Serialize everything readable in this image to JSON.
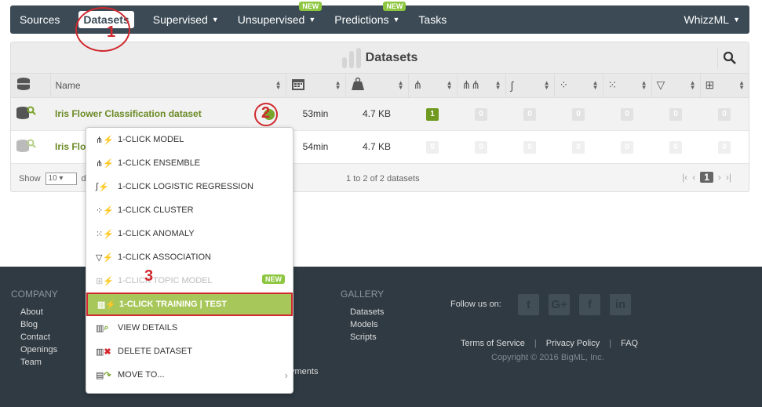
{
  "nav": {
    "items": [
      {
        "label": "Sources",
        "caret": false,
        "badge": ""
      },
      {
        "label": "Datasets",
        "caret": false,
        "badge": "",
        "active": true
      },
      {
        "label": "Supervised",
        "caret": true,
        "badge": ""
      },
      {
        "label": "Unsupervised",
        "caret": true,
        "badge": "NEW"
      },
      {
        "label": "Predictions",
        "caret": true,
        "badge": "NEW"
      },
      {
        "label": "Tasks",
        "caret": false,
        "badge": ""
      }
    ],
    "user": "WhizzML"
  },
  "panel": {
    "title": "Datasets",
    "columns": {
      "name": "Name"
    },
    "rows": [
      {
        "name": "Iris Flower Classification dataset",
        "age": "53min",
        "size": "4.7 KB",
        "counts": [
          "1",
          "0",
          "0",
          "0",
          "0",
          "0",
          "0"
        ]
      },
      {
        "name": "Iris Flo",
        "age": "54min",
        "size": "4.7 KB",
        "counts": [
          "0",
          "0",
          "0",
          "0",
          "0",
          "0",
          "0"
        ]
      }
    ],
    "footer": {
      "show_label": "Show",
      "page_size": "10",
      "range": "1 to 2 of 2 datasets",
      "page": "1",
      "trail": "d"
    }
  },
  "menu": {
    "items": [
      {
        "label": "1-CLICK MODEL",
        "icon": "model-icon"
      },
      {
        "label": "1-CLICK ENSEMBLE",
        "icon": "ensemble-icon"
      },
      {
        "label": "1-CLICK LOGISTIC REGRESSION",
        "icon": "logistic-icon"
      },
      {
        "label": "1-CLICK CLUSTER",
        "icon": "cluster-icon"
      },
      {
        "label": "1-CLICK ANOMALY",
        "icon": "anomaly-icon"
      },
      {
        "label": "1-CLICK ASSOCIATION",
        "icon": "association-icon"
      },
      {
        "label": "1-CLICK TOPIC MODEL",
        "icon": "topic-model-icon",
        "badge": "NEW"
      },
      {
        "label": "1-CLICK TRAINING | TEST",
        "icon": "training-test-icon"
      },
      {
        "label": "VIEW DETAILS",
        "icon": "view-details-icon"
      },
      {
        "label": "DELETE DATASET",
        "icon": "delete-icon"
      },
      {
        "label": "MOVE TO...",
        "icon": "move-to-icon"
      }
    ]
  },
  "footer": {
    "company_title": "COMPANY",
    "company_links": [
      "About",
      "Blog",
      "Contact",
      "Openings",
      "Team"
    ],
    "gallery_title": "GALLERY",
    "gallery_links": [
      "Datasets",
      "Models",
      "Scripts"
    ],
    "partial_text": "yments",
    "follow": "Follow us on:",
    "social": [
      "twitter-icon",
      "google-plus-icon",
      "facebook-icon",
      "linkedin-icon"
    ],
    "legal": [
      "Terms of Service",
      "Privacy Policy",
      "FAQ"
    ],
    "copyright": "Copyright © 2016 BigML, Inc."
  },
  "annotations": [
    "1",
    "2",
    "3"
  ],
  "colors": {
    "nav_bg": "#3b4a55",
    "accent_green": "#8dc63f",
    "highlight": "#a8c75b",
    "annotation_red": "#d0292e"
  }
}
